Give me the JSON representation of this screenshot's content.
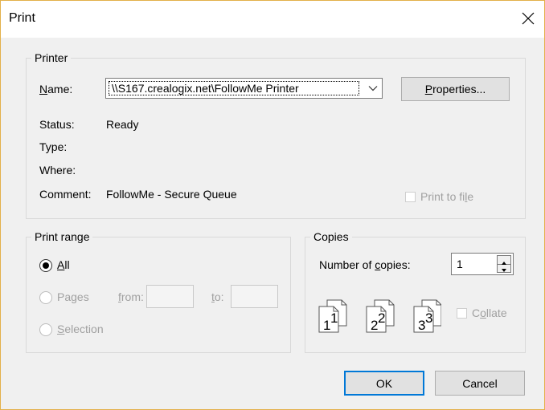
{
  "window": {
    "title": "Print"
  },
  "printer": {
    "legend": "Printer",
    "name_label": "Name:",
    "name_value": "\\\\S167.crealogix.net\\FollowMe Printer",
    "properties_label": "Properties...",
    "status_label": "Status:",
    "status_value": "Ready",
    "type_label": "Type:",
    "where_label": "Where:",
    "comment_label": "Comment:",
    "comment_value": "FollowMe - Secure Queue",
    "print_to_file_label": "Print to file",
    "print_to_file_checked": false
  },
  "print_range": {
    "legend": "Print range",
    "all_label": "All",
    "pages_label": "Pages",
    "from_label": "from:",
    "to_label": "to:",
    "selection_label": "Selection",
    "selected": "All"
  },
  "copies": {
    "legend": "Copies",
    "number_label": "Number of copies:",
    "number_value": "1",
    "collate_label": "Collate",
    "collate_checked": false,
    "collate_numbers": [
      "1",
      "1",
      "2",
      "2",
      "3",
      "3"
    ]
  },
  "buttons": {
    "ok_label": "OK",
    "cancel_label": "Cancel"
  },
  "colors": {
    "dialog_bg": "#f0f0f0",
    "accent_border": "#0078d7",
    "window_border": "#e3b04a"
  },
  "icons": [
    "close-icon",
    "chevron-down-icon",
    "spin-up-icon",
    "spin-down-icon",
    "collate-pages-icon"
  ]
}
